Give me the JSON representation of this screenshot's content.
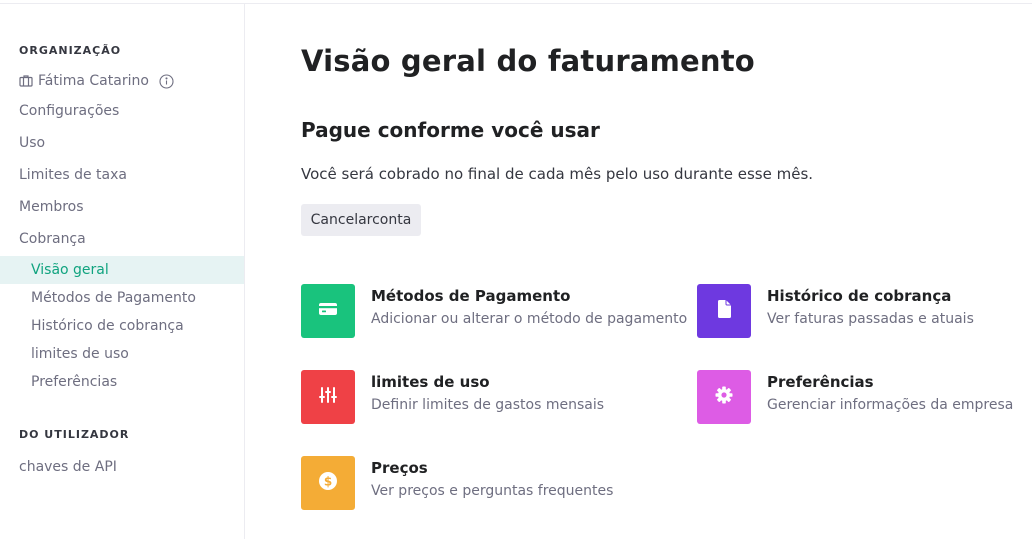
{
  "sidebar": {
    "org_header": "ORGANIZAÇÃO",
    "org_name": "Fátima Catarino",
    "items": [
      {
        "label": "Configurações"
      },
      {
        "label": "Uso"
      },
      {
        "label": "Limites de taxa"
      },
      {
        "label": "Membros"
      },
      {
        "label": "Cobrança"
      }
    ],
    "billing_sub": [
      {
        "label": "Visão geral",
        "active": true
      },
      {
        "label": "Métodos de Pagamento"
      },
      {
        "label": "Histórico de cobrança"
      },
      {
        "label": "limites de uso"
      },
      {
        "label": "Preferências"
      }
    ],
    "user_header": "DO UTILIZADOR",
    "user_items": [
      {
        "label": "chaves de API"
      }
    ]
  },
  "main": {
    "title": "Visão geral do faturamento",
    "plan_title": "Pague conforme você usar",
    "plan_desc": "Você será cobrado no final de cada mês pelo uso durante esse mês.",
    "cancel_label": "Cancelarconta",
    "cards": [
      {
        "title": "Métodos de Pagamento",
        "desc": "Adicionar ou alterar o método de pagamento",
        "color": "#19c37d",
        "icon": "credit-card-icon"
      },
      {
        "title": "Histórico de cobrança",
        "desc": "Ver faturas passadas e atuais",
        "color": "#6e39e0",
        "icon": "document-icon"
      },
      {
        "title": "limites de uso",
        "desc": "Definir limites de gastos mensais",
        "color": "#ef4146",
        "icon": "sliders-icon"
      },
      {
        "title": "Preferências",
        "desc": "Gerenciar informações da empresa",
        "color": "#dd5ce5",
        "icon": "gear-icon"
      },
      {
        "title": "Preços",
        "desc": "Ver preços e perguntas frequentes",
        "color": "#f4ac36",
        "icon": "dollar-icon"
      }
    ]
  }
}
